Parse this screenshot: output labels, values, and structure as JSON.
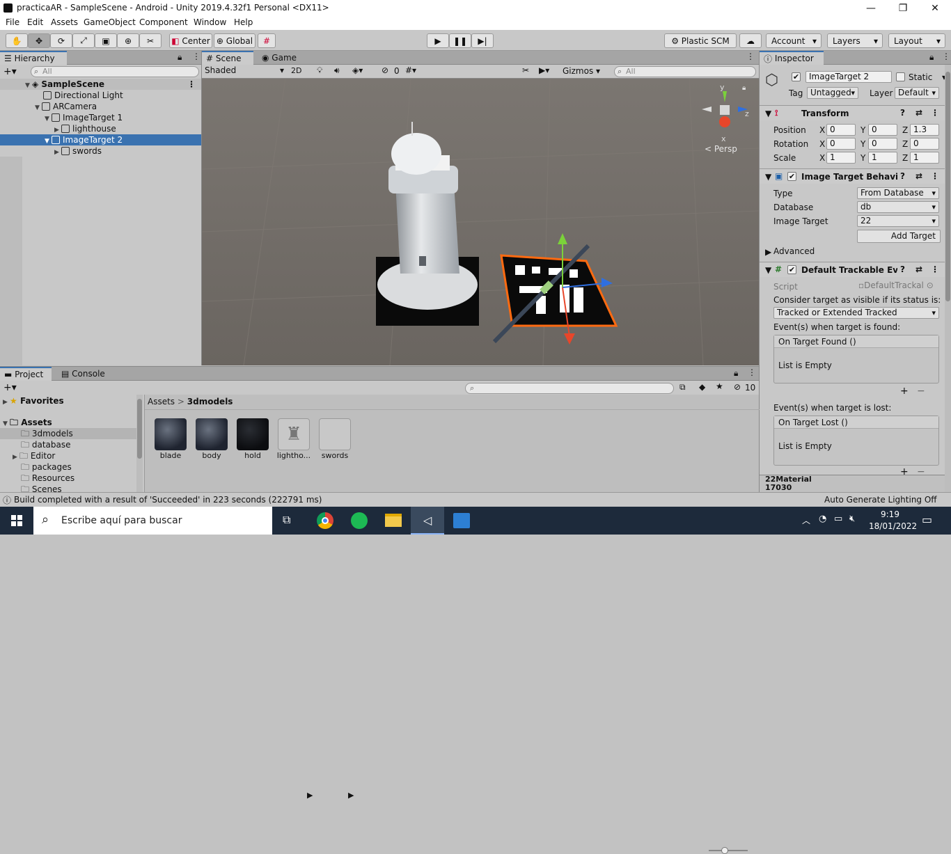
{
  "window": {
    "title": "practicaAR - SampleScene - Android - Unity 2019.4.32f1 Personal <DX11>",
    "minimize": "—",
    "maximize": "❐",
    "close": "✕"
  },
  "menu": [
    "File",
    "Edit",
    "Assets",
    "GameObject",
    "Component",
    "Window",
    "Help"
  ],
  "toolbar": {
    "pivot": "Center",
    "space": "Global",
    "plastic": "Plastic SCM",
    "account": "Account",
    "layers": "Layers",
    "layout": "Layout"
  },
  "hierarchy": {
    "tab": "Hierarchy",
    "search_placeholder": "All",
    "scene": "SampleScene",
    "items": [
      {
        "label": "Directional Light"
      },
      {
        "label": "ARCamera"
      },
      {
        "label": "ImageTarget 1"
      },
      {
        "label": "lighthouse"
      },
      {
        "label": "ImageTarget 2"
      },
      {
        "label": "swords"
      }
    ]
  },
  "scene": {
    "tab_scene": "Scene",
    "tab_game": "Game",
    "shading": "Shaded",
    "mode2d": "2D",
    "hidden_count": "0",
    "gizmos": "Gizmos",
    "search_placeholder": "All",
    "persp": "< Persp",
    "axis_y": "y",
    "axis_z": "z",
    "axis_x": "x"
  },
  "inspector": {
    "tab": "Inspector",
    "object_name": "ImageTarget 2",
    "static_label": "Static",
    "tag_label": "Tag",
    "tag_value": "Untagged",
    "layer_label": "Layer",
    "layer_value": "Default",
    "transform": {
      "title": "Transform",
      "position_label": "Position",
      "rotation_label": "Rotation",
      "scale_label": "Scale",
      "position": [
        "0",
        "0",
        "1.3"
      ],
      "rotation": [
        "0",
        "0",
        "0"
      ],
      "scale": [
        "1",
        "1",
        "1"
      ],
      "x": "X",
      "y": "Y",
      "z": "Z"
    },
    "itb": {
      "title": "Image Target Behaviour",
      "type_label": "Type",
      "type_value": "From Database",
      "db_label": "Database",
      "db_value": "db",
      "target_label": "Image Target",
      "target_value": "22",
      "add_target": "Add Target",
      "advanced": "Advanced"
    },
    "dte": {
      "title": "Default Trackable Even",
      "script_label": "Script",
      "script_value": "DefaultTrackal",
      "consider": "Consider target as visible if its status is:",
      "status_value": "Tracked or Extended Tracked",
      "found_label": "Event(s) when target is found:",
      "on_found": "On Target Found ()",
      "empty1": "List is Empty",
      "lost_label": "Event(s) when target is lost:",
      "on_lost": "On Target Lost ()",
      "empty2": "List is Empty",
      "plus": "+",
      "minus": "−"
    },
    "footer_top": "22Material",
    "footer_bottom": "17030"
  },
  "project": {
    "tab_project": "Project",
    "tab_console": "Console",
    "favorites": "Favorites",
    "assets": "Assets",
    "folders": [
      "3dmodels",
      "database",
      "Editor",
      "packages",
      "Resources",
      "Scenes"
    ],
    "breadcrumb_root": "Assets",
    "breadcrumb_sep": ">",
    "breadcrumb_current": "3dmodels",
    "badge": "10",
    "items": [
      {
        "name": "blade"
      },
      {
        "name": "body"
      },
      {
        "name": "hold"
      },
      {
        "name": "lightho..."
      },
      {
        "name": "swords"
      }
    ]
  },
  "status": {
    "message": "Build completed with a result of 'Succeeded' in 223 seconds (222791 ms)",
    "right": "Auto Generate Lighting Off"
  },
  "taskbar": {
    "search_placeholder": "Escribe aquí para buscar",
    "time": "9:19",
    "date": "18/01/2022"
  }
}
